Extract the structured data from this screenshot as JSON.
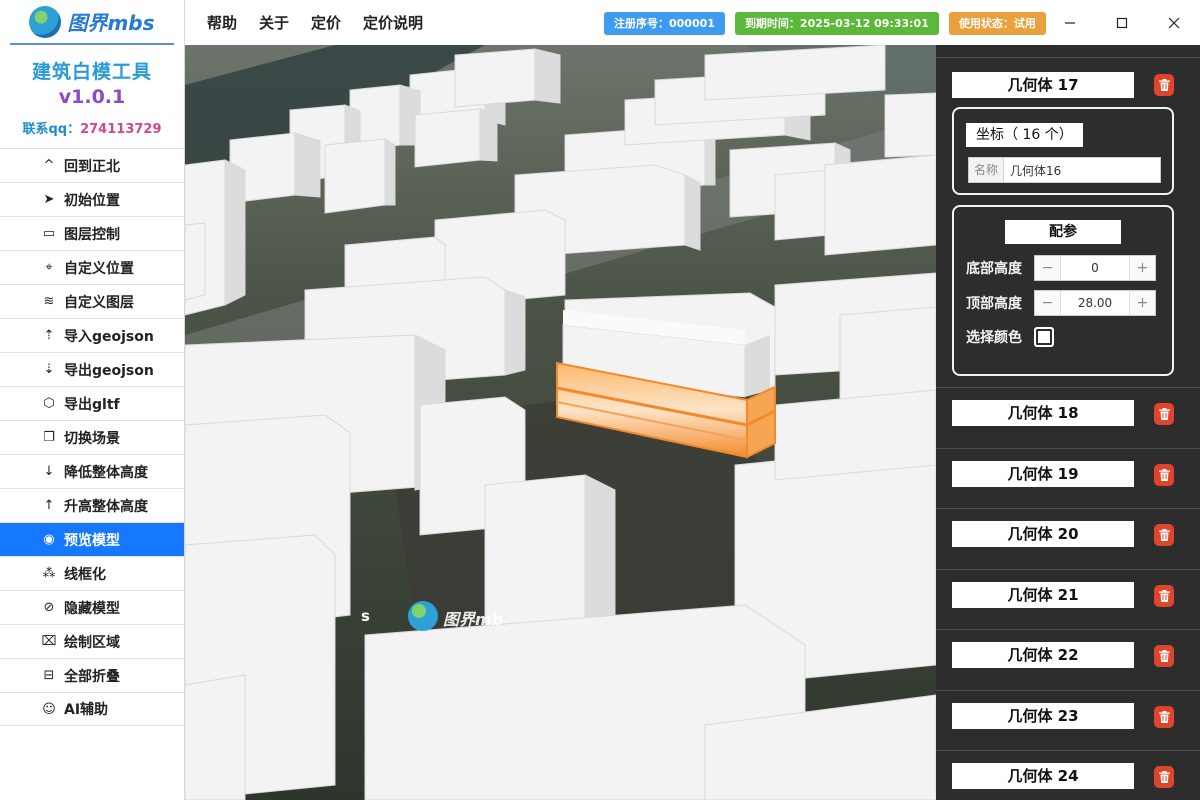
{
  "brand": {
    "logo_text": "图界mbs",
    "app_title": "建筑白模工具",
    "version": "v1.0.1",
    "contact_label": "联系qq：",
    "contact_qq": "274113729"
  },
  "menu": [
    {
      "label": "回到正北",
      "icon": "chevron-up-icon"
    },
    {
      "label": "初始位置",
      "icon": "navigate-arrow-icon"
    },
    {
      "label": "图层控制",
      "icon": "layers-tray-icon"
    },
    {
      "label": "自定义位置",
      "icon": "map-pin-icon"
    },
    {
      "label": "自定义图层",
      "icon": "stack-icon"
    },
    {
      "label": "导入geojson",
      "icon": "upload-icon"
    },
    {
      "label": "导出geojson",
      "icon": "download-icon"
    },
    {
      "label": "导出gltf",
      "icon": "cube-icon"
    },
    {
      "label": "切换场景",
      "icon": "switch-scene-icon"
    },
    {
      "label": "降低整体高度",
      "icon": "arrow-down-thin-icon"
    },
    {
      "label": "升高整体高度",
      "icon": "arrow-up-thin-icon"
    },
    {
      "label": "预览模型",
      "icon": "eye-icon",
      "active": true
    },
    {
      "label": "线框化",
      "icon": "wireframe-icon"
    },
    {
      "label": "隐藏模型",
      "icon": "eye-off-icon"
    },
    {
      "label": "绘制区域",
      "icon": "draw-area-icon"
    },
    {
      "label": "全部折叠",
      "icon": "collapse-icon"
    },
    {
      "label": "AI辅助",
      "icon": "ai-head-icon"
    }
  ],
  "topbar": {
    "menus": [
      "帮助",
      "关于",
      "定价",
      "定价说明"
    ],
    "badges": {
      "registration": "注册序号：000001",
      "expiry": "到期时间：2025-03-12 09:33:01",
      "status": "使用状态：试用"
    },
    "badge_colors": {
      "registration": "#3d9cf0",
      "expiry": "#5bb83a",
      "status": "#eaa13d"
    }
  },
  "viewport": {
    "watermark_text": "图界mb",
    "watermark_prefix": "s"
  },
  "panel": {
    "top_item": "几何体 17",
    "coord_header": "坐标",
    "coord_count": "（ 16 个）",
    "name_label": "名称",
    "name_value": "几何体16",
    "param_header": "配参",
    "bottom_height_label": "底部高度",
    "bottom_height_value": "0",
    "top_height_label": "顶部高度",
    "top_height_value": "28.00",
    "color_label": "选择颜色",
    "items": [
      "几何体 18",
      "几何体 19",
      "几何体 20",
      "几何体 21",
      "几何体 22",
      "几何体 23",
      "几何体 24"
    ]
  },
  "colors": {
    "accent": "#1677ff",
    "delete": "#e0452b",
    "highlight": "#f08a2a"
  }
}
